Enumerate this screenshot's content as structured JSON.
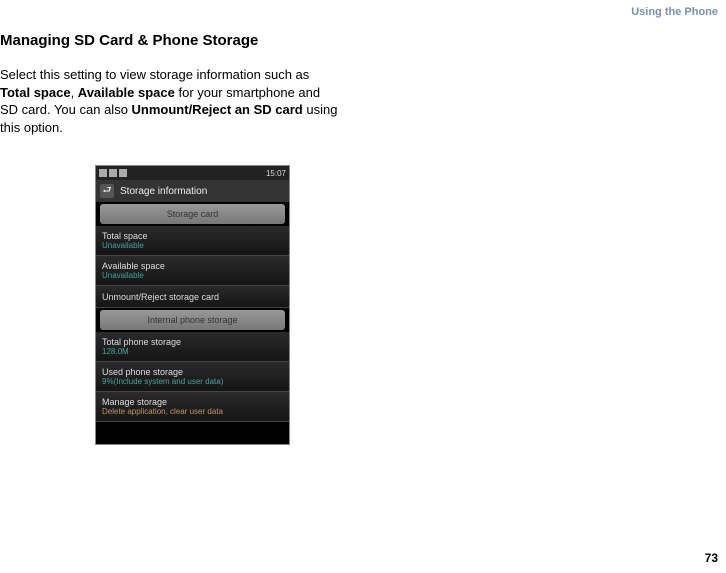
{
  "header": {
    "chapter": "Using the Phone"
  },
  "section": {
    "title": "Managing SD Card & Phone Storage"
  },
  "body": {
    "text1": "Select this setting to view storage information such as ",
    "bold1": "Total space",
    "text2": ", ",
    "bold2": "Available space",
    "text3": " for your smartphone and SD card. You can also ",
    "bold3": "Unmount/Reject an SD card",
    "text4": " using this option."
  },
  "screenshot": {
    "time": "15:07",
    "title": "Storage information",
    "category1": "Storage card",
    "items": [
      {
        "label": "Total space",
        "value": "Unavailable"
      },
      {
        "label": "Available space",
        "value": "Unavailable"
      },
      {
        "label": "Unmount/Reject storage card",
        "value": ""
      }
    ],
    "category2": "Internal phone storage",
    "items2": [
      {
        "label": "Total phone storage",
        "value": "128.0M"
      },
      {
        "label": "Used phone storage",
        "value": "9%(Include system and user data)"
      },
      {
        "label": "Manage storage",
        "value": "Delete application, clear user data"
      }
    ]
  },
  "page": {
    "number": "73"
  }
}
